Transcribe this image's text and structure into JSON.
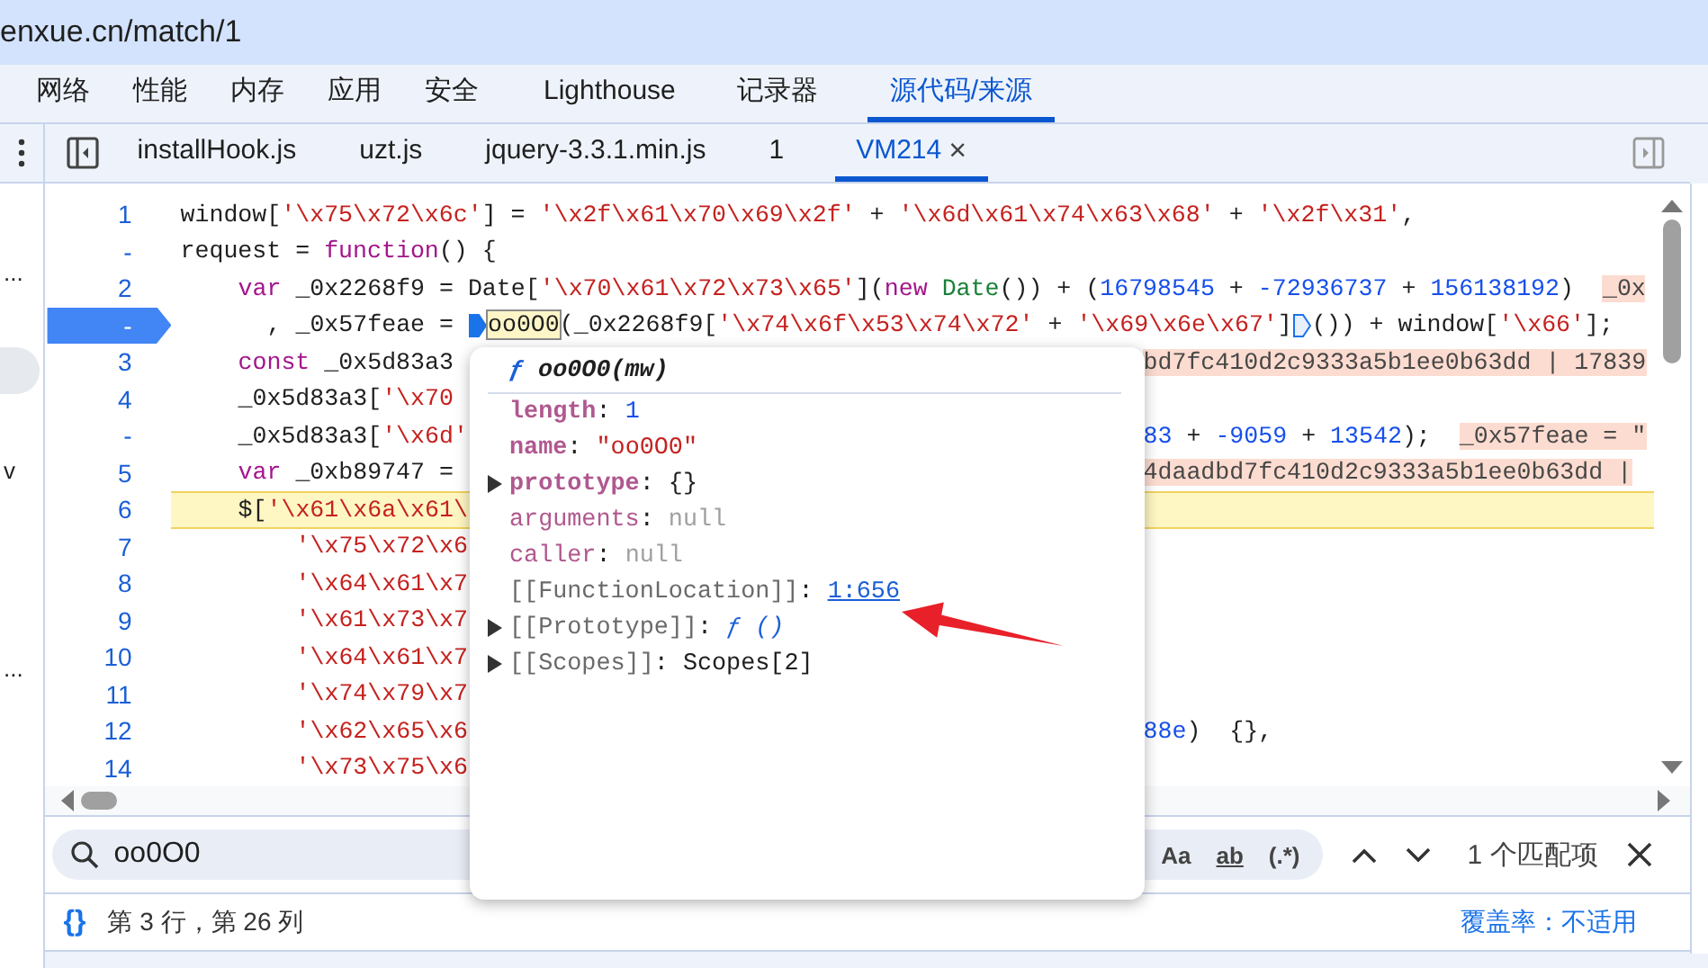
{
  "address_bar": {
    "url": "enxue.cn/match/1"
  },
  "panel_tabs": [
    {
      "label": "网络",
      "selected": false
    },
    {
      "label": "性能",
      "selected": false
    },
    {
      "label": "内存",
      "selected": false
    },
    {
      "label": "应用",
      "selected": false
    },
    {
      "label": "安全",
      "selected": false
    },
    {
      "label": "Lighthouse",
      "selected": false
    },
    {
      "label": "记录器",
      "selected": false
    },
    {
      "label": "源代码/来源",
      "selected": true
    }
  ],
  "sidebar": {
    "fragments": [
      "...",
      "v",
      "..."
    ]
  },
  "file_tabs": [
    {
      "label": "installHook.js",
      "selected": false
    },
    {
      "label": "uzt.js",
      "selected": false
    },
    {
      "label": "jquery-3.3.1.min.js",
      "selected": false
    },
    {
      "label": "1",
      "selected": false
    },
    {
      "label": "VM214",
      "selected": true,
      "close": "×"
    }
  ],
  "code_lines": [
    {
      "number": "1",
      "kind": "top",
      "breakpoint": false,
      "paused": false,
      "segments": [
        {
          "kind": "plain",
          "text": "window["
        },
        {
          "kind": "string",
          "text": "'\\x75\\x72\\x6c'"
        },
        {
          "kind": "plain",
          "text": "] = "
        },
        {
          "kind": "string",
          "text": "'\\x2f\\x61\\x70\\x69\\x2f'"
        },
        {
          "kind": "plain",
          "text": " + "
        },
        {
          "kind": "string",
          "text": "'\\x6d\\x61\\x74\\x63\\x68'"
        },
        {
          "kind": "plain",
          "text": " + "
        },
        {
          "kind": "string",
          "text": "'\\x2f\\x31'"
        },
        {
          "kind": "plain",
          "text": ","
        }
      ]
    },
    {
      "number": "-",
      "kind": "top",
      "breakpoint": false,
      "paused": false,
      "segments": [
        {
          "kind": "plain",
          "text": "request = "
        },
        {
          "kind": "keyword",
          "text": "function"
        },
        {
          "kind": "plain",
          "text": "() {"
        }
      ]
    },
    {
      "number": "2",
      "kind": "inner",
      "breakpoint": false,
      "paused": false,
      "segments": [
        {
          "kind": "keyword",
          "text": "var"
        },
        {
          "kind": "plain",
          "text": " _0x2268f9 = Date["
        },
        {
          "kind": "string",
          "text": "'\\x70\\x61\\x72\\x73\\x65'"
        },
        {
          "kind": "plain",
          "text": "]("
        },
        {
          "kind": "keyword",
          "text": "new"
        },
        {
          "kind": "class",
          "text": " Date"
        },
        {
          "kind": "plain",
          "text": "()) + ("
        },
        {
          "kind": "number",
          "text": "16798545"
        },
        {
          "kind": "plain",
          "text": " + "
        },
        {
          "kind": "number",
          "text": "-72936737"
        },
        {
          "kind": "plain",
          "text": " + "
        },
        {
          "kind": "number",
          "text": "156138192"
        },
        {
          "kind": "plain",
          "text": ")  "
        },
        {
          "kind": "inline",
          "text": "_0x"
        }
      ]
    },
    {
      "number": "-",
      "kind": "continuation",
      "breakpoint": true,
      "paused": false,
      "segments": [
        {
          "kind": "plain",
          "text": ", _0x57feae = "
        },
        {
          "kind": "marker",
          "active": true
        },
        {
          "kind": "hover",
          "text": "oo0O0"
        },
        {
          "kind": "plain",
          "text": "(_0x2268f9["
        },
        {
          "kind": "string",
          "text": "'\\x74\\x6f\\x53\\x74\\x72'"
        },
        {
          "kind": "plain",
          "text": " + "
        },
        {
          "kind": "string",
          "text": "'\\x69\\x6e\\x67'"
        },
        {
          "kind": "plain",
          "text": "]"
        },
        {
          "kind": "marker",
          "active": false
        },
        {
          "kind": "plain",
          "text": "()) + window["
        },
        {
          "kind": "string",
          "text": "'\\x66'"
        },
        {
          "kind": "plain",
          "text": "];"
        }
      ]
    },
    {
      "number": "3",
      "kind": "inner",
      "breakpoint": false,
      "paused": false,
      "segments": [
        {
          "kind": "keyword",
          "text": "const"
        },
        {
          "kind": "plain",
          "text": " _0x5d83a3"
        }
      ],
      "tail": [
        {
          "kind": "inline",
          "text": "bd7fc410d2c9333a5b1ee0b63dd | 17839"
        }
      ]
    },
    {
      "number": "4",
      "kind": "inner",
      "breakpoint": false,
      "paused": false,
      "segments": [
        {
          "kind": "plain",
          "text": "_0x5d83a3["
        },
        {
          "kind": "string",
          "text": "'\\x70"
        }
      ]
    },
    {
      "number": "-",
      "kind": "inner",
      "breakpoint": false,
      "paused": false,
      "segments": [
        {
          "kind": "plain",
          "text": "_0x5d83a3["
        },
        {
          "kind": "string",
          "text": "'\\x6d'"
        }
      ],
      "tail": [
        {
          "kind": "number",
          "text": "83"
        },
        {
          "kind": "plain",
          "text": " + "
        },
        {
          "kind": "number",
          "text": "-9059"
        },
        {
          "kind": "plain",
          "text": " + "
        },
        {
          "kind": "number",
          "text": "13542"
        },
        {
          "kind": "plain",
          "text": ");  "
        },
        {
          "kind": "inline",
          "text": "_0x57feae = \""
        }
      ]
    },
    {
      "number": "5",
      "kind": "inner",
      "breakpoint": false,
      "paused": false,
      "segments": [
        {
          "kind": "keyword",
          "text": "var"
        },
        {
          "kind": "plain",
          "text": " _0xb89747 ="
        }
      ],
      "tail": [
        {
          "kind": "inline",
          "text": "4daadbd7fc410d2c9333a5b1ee0b63dd |"
        }
      ]
    },
    {
      "number": "6",
      "kind": "inner",
      "breakpoint": false,
      "paused": true,
      "segments": [
        {
          "kind": "plain",
          "text": "$["
        },
        {
          "kind": "string",
          "text": "'\\x61\\x6a\\x61\\"
        }
      ]
    },
    {
      "number": "7",
      "kind": "argument",
      "breakpoint": false,
      "paused": false,
      "segments": [
        {
          "kind": "string",
          "text": "'\\x75\\x72\\x6"
        }
      ]
    },
    {
      "number": "8",
      "kind": "argument",
      "breakpoint": false,
      "paused": false,
      "segments": [
        {
          "kind": "string",
          "text": "'\\x64\\x61\\x7"
        }
      ]
    },
    {
      "number": "9",
      "kind": "argument",
      "breakpoint": false,
      "paused": false,
      "segments": [
        {
          "kind": "string",
          "text": "'\\x61\\x73\\x7"
        }
      ]
    },
    {
      "number": "10",
      "kind": "argument",
      "breakpoint": false,
      "paused": false,
      "segments": [
        {
          "kind": "string",
          "text": "'\\x64\\x61\\x7"
        }
      ]
    },
    {
      "number": "11",
      "kind": "argument",
      "breakpoint": false,
      "paused": false,
      "segments": [
        {
          "kind": "string",
          "text": "'\\x74\\x79\\x7"
        }
      ]
    },
    {
      "number": "12",
      "kind": "argument",
      "breakpoint": false,
      "paused": false,
      "segments": [
        {
          "kind": "string",
          "text": "'\\x62\\x65\\x6"
        }
      ],
      "tail": [
        {
          "kind": "number",
          "text": "88e"
        },
        {
          "kind": "plain",
          "text": ")  {},"
        }
      ]
    },
    {
      "number": "14",
      "kind": "argument",
      "breakpoint": false,
      "paused": false,
      "segments": [
        {
          "kind": "string",
          "text": "'\\x73\\x75\\x6"
        }
      ]
    }
  ],
  "popover": {
    "icon": "ƒ",
    "signature": "oo0O0(mw)",
    "properties": [
      {
        "key": "length",
        "separator": ":",
        "value": "1",
        "kind": "number",
        "own": true,
        "internal": false,
        "expandable": false
      },
      {
        "key": "name",
        "separator": ":",
        "value": "\"oo0O0\"",
        "kind": "string",
        "own": true,
        "internal": false,
        "expandable": false
      },
      {
        "key": "prototype",
        "separator": ":",
        "value": "{}",
        "kind": "object",
        "own": true,
        "internal": false,
        "expandable": true
      },
      {
        "key": "arguments",
        "separator": ":",
        "value": "null",
        "kind": "null",
        "own": false,
        "internal": false,
        "expandable": false
      },
      {
        "key": "caller",
        "separator": ":",
        "value": "null",
        "kind": "null",
        "own": false,
        "internal": false,
        "expandable": false
      },
      {
        "key": "[[FunctionLocation]]",
        "separator": ":",
        "value": "1:656",
        "kind": "link",
        "own": false,
        "internal": true,
        "expandable": false
      },
      {
        "key": "[[Prototype]]",
        "separator": ":",
        "value": "ƒ ()",
        "kind": "function",
        "own": false,
        "internal": true,
        "expandable": true
      },
      {
        "key": "[[Scopes]]",
        "separator": ":",
        "value": "Scopes[2]",
        "kind": "object",
        "own": false,
        "internal": true,
        "expandable": true
      }
    ]
  },
  "search": {
    "value": "oo0O0",
    "options": [
      "Aa",
      "ab",
      "(.*)"
    ],
    "match_count": "1 个匹配项"
  },
  "status_bar": {
    "format_button": "{}",
    "position": "第 3 行，第 26 列",
    "coverage": "覆盖率：不适用"
  }
}
